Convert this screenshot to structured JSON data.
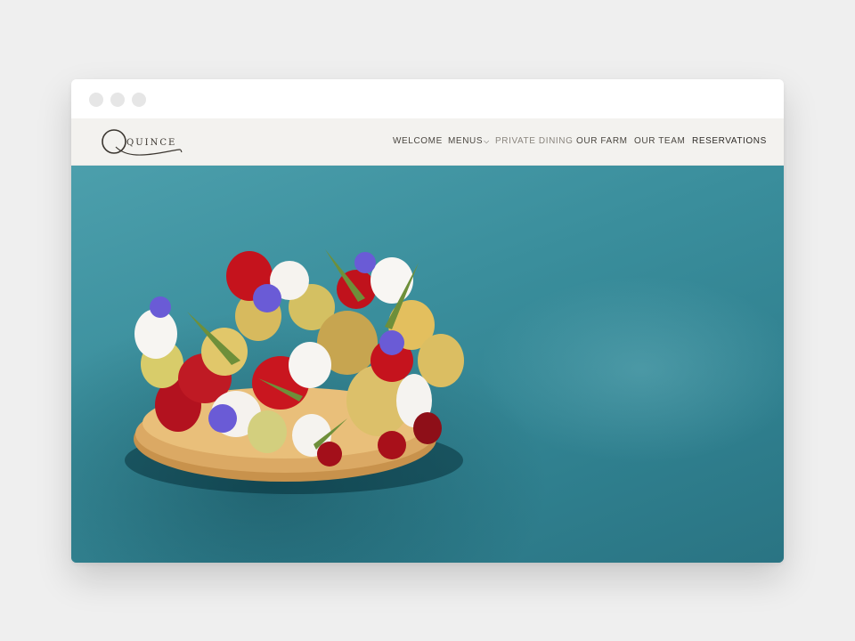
{
  "browser": {
    "window_controls": [
      "close-dot",
      "minimize-dot",
      "maximize-dot"
    ]
  },
  "brand": {
    "logo_text": "QUINCE"
  },
  "nav": {
    "items": [
      {
        "label": "WELCOME"
      },
      {
        "label": "MENUS",
        "has_dropdown": true
      },
      {
        "label": "PRIVATE DINING",
        "active": true
      },
      {
        "label": "OUR FARM"
      },
      {
        "label": "OUR TEAM"
      },
      {
        "label": "RESERVATIONS"
      }
    ]
  },
  "hero": {
    "image_subject": "wild strawberry tart with meringue and blue flowers on teal plate"
  },
  "colors": {
    "page_bg": "#efefef",
    "nav_bg": "#f9f6f2",
    "hero_teal": "#3a8e9c",
    "nav_text": "#4a4640"
  }
}
